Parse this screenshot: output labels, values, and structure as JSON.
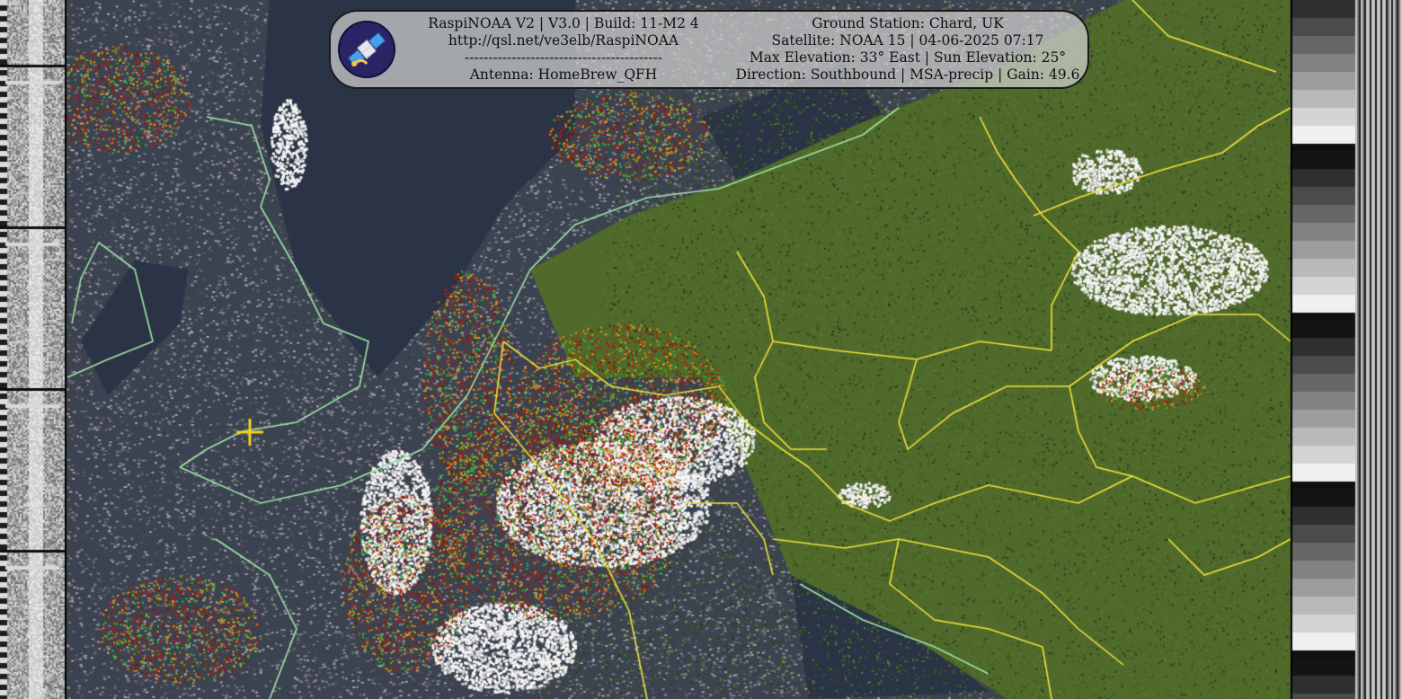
{
  "image": {
    "description_kind": "NOAA APT weather satellite image with map overlay",
    "colors": {
      "land_green": "#4f6a2a",
      "sea_dark": "#2a3446",
      "cloud_white": "#f4f4f4",
      "precip_red": "#b51a0f",
      "coast_lightgreen": "#9fe6a8",
      "borders_yellow": "#f2e23a"
    },
    "station_marker": "yellow-cross-icon"
  },
  "overlay": {
    "left_lines": [
      "RaspiNOAA V2 | V3.0 | Build: 11-M2 4",
      "http://qsl.net/ve3elb/RaspiNOAA",
      "------------------------------------------",
      "Antenna: HomeBrew_QFH"
    ],
    "right_lines": [
      "Ground Station: Chard, UK",
      "Satellite: NOAA 15 | 04-06-2025 07:17",
      "Max Elevation: 33° East | Sun Elevation: 25°",
      "Direction: Southbound | MSA-precip | Gain: 49.6"
    ],
    "logo_icon": "satellite-icon"
  }
}
